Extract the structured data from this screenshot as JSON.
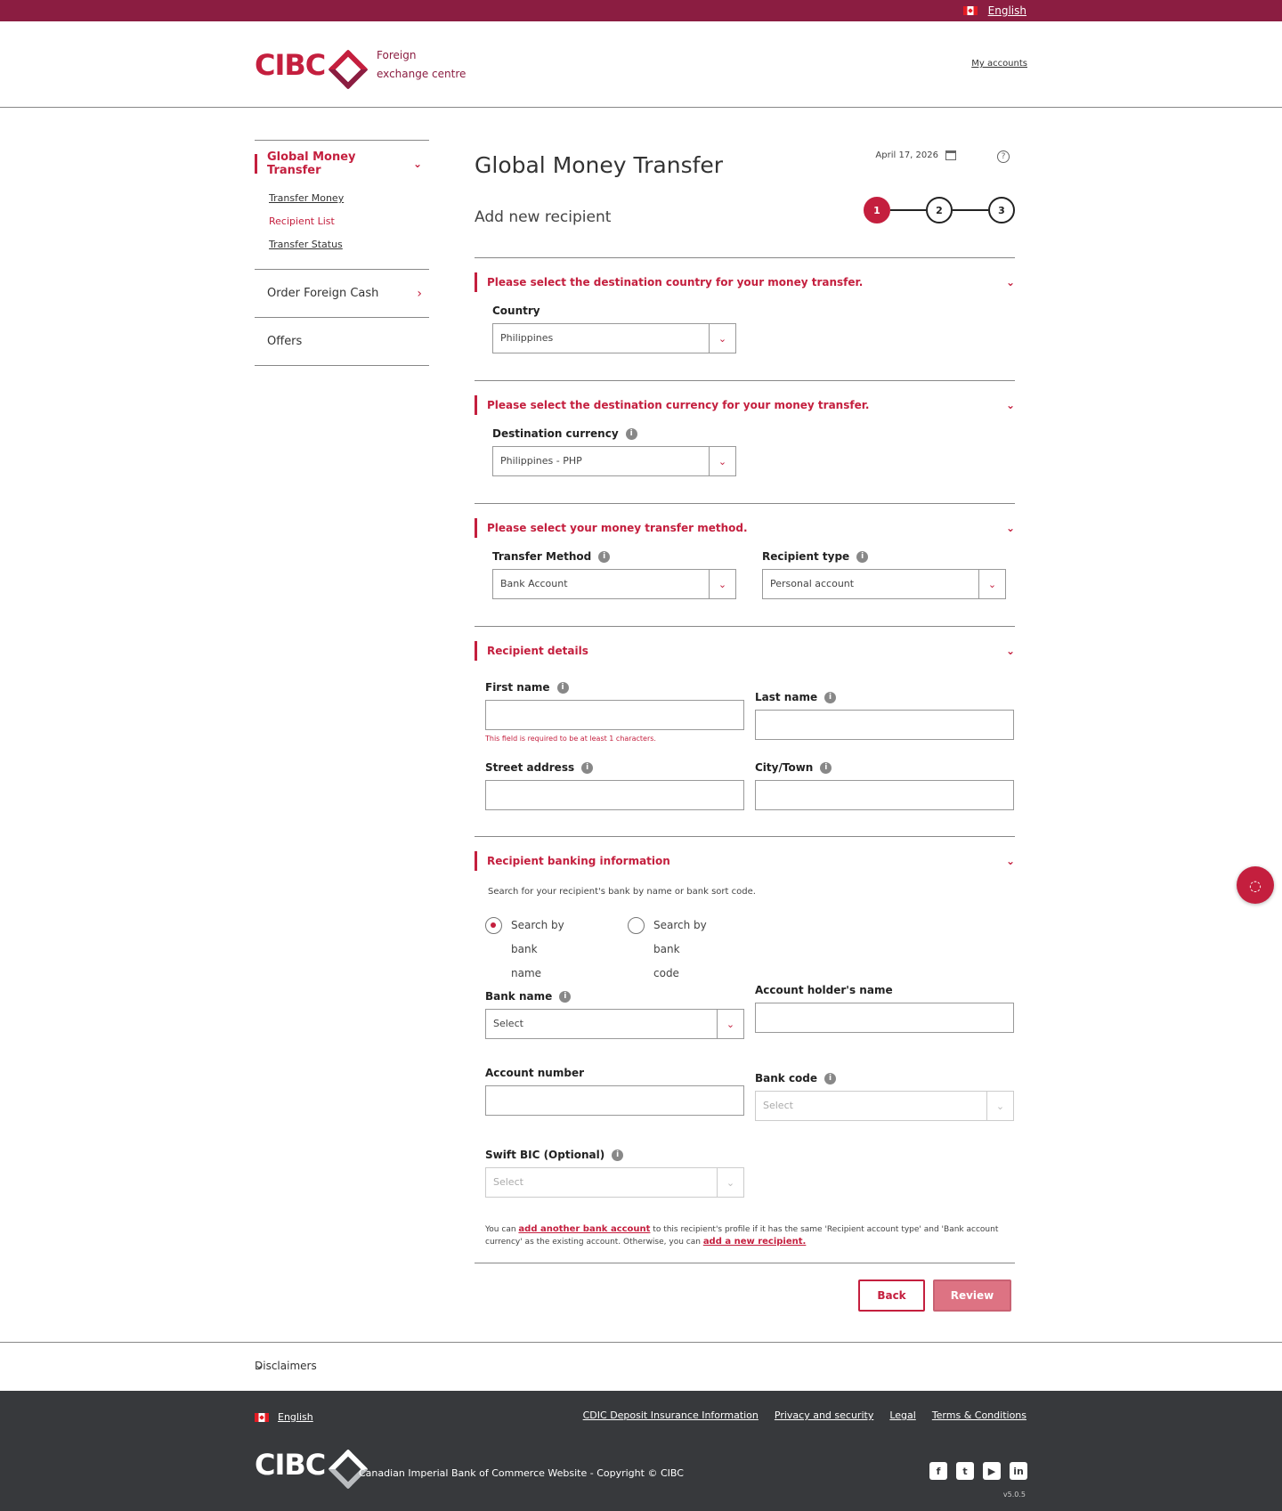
{
  "topbar": {
    "language": "English"
  },
  "header": {
    "logo_text": "CIBC",
    "subtitle_line1": "Foreign",
    "subtitle_line2": "exchange centre",
    "my_accounts": "My accounts"
  },
  "sidebar": {
    "group1": {
      "label": "Global Money Transfer",
      "items": [
        {
          "label": "Transfer Money"
        },
        {
          "label": "Recipient List"
        },
        {
          "label": "Transfer Status"
        }
      ]
    },
    "order_cash": "Order Foreign Cash",
    "offers": "Offers"
  },
  "main": {
    "title": "Global Money Transfer",
    "subtitle": "Add new recipient",
    "date": "April 17, 2026",
    "help_glyph": "?",
    "steps": [
      "1",
      "2",
      "3"
    ],
    "sections": {
      "country": {
        "heading": "Please select the destination country for your money transfer.",
        "field_label": "Country",
        "value": "Philippines"
      },
      "currency": {
        "heading": "Please select the destination currency for your money transfer.",
        "field_label": "Destination currency",
        "value": "Philippines - PHP"
      },
      "method": {
        "heading": "Please select your money transfer method.",
        "method_label": "Transfer Method",
        "method_value": "Bank Account",
        "type_label": "Recipient type",
        "type_value": "Personal account"
      },
      "recipient": {
        "heading": "Recipient details",
        "first_name": "First name",
        "first_name_error": "This field is required to be at least 1 characters.",
        "last_name": "Last name",
        "street": "Street address",
        "city": "City/Town"
      },
      "banking": {
        "heading": "Recipient banking information",
        "hint": "Search for your recipient's bank by name or bank sort code.",
        "radio_name_1": "Search by bank",
        "radio_name_2": "name",
        "radio_code_1": "Search by bank",
        "radio_code_2": "code",
        "bank_name_label": "Bank name",
        "bank_name_value": "Select",
        "holder_label": "Account holder's name",
        "account_number_label": "Account number",
        "bank_code_label": "Bank code",
        "bank_code_value": "Select",
        "swift_label": "Swift BIC (Optional)",
        "swift_value": "Select"
      }
    },
    "note": {
      "part1": "You can ",
      "link1": "add another bank account",
      "part2": " to this recipient's profile if it has the same 'Recipient account type' and 'Bank account currency' as the existing account. Otherwise, you can ",
      "link2": "add a new recipient."
    },
    "buttons": {
      "back": "Back",
      "review": "Review"
    }
  },
  "disclaimers": "Disclaimers",
  "footer": {
    "language": "English",
    "links": [
      "CDIC Deposit Insurance Information",
      "Privacy and security",
      "Legal",
      "Terms & Conditions"
    ],
    "logo_text": "CIBC",
    "copyright": "Canadian Imperial Bank of Commerce Website - Copyright © CIBC",
    "social": [
      "f",
      "t",
      "▶",
      "in"
    ],
    "version": "v5.0.5"
  },
  "colors": {
    "brand": "#c41f3e",
    "brand_dark": "#8b1d41",
    "footer_bg": "#37393c"
  }
}
